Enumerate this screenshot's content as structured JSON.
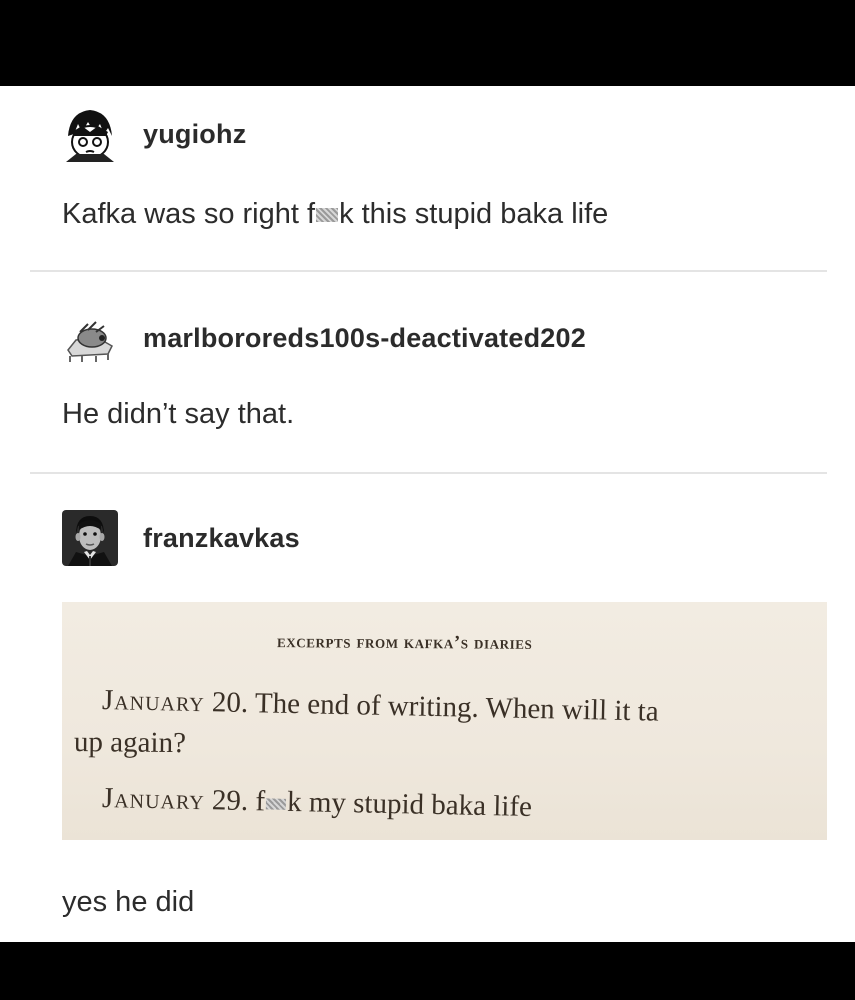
{
  "posts": [
    {
      "username": "yugiohz",
      "avatar_icon": "anime-avatar-icon",
      "text_before": "Kafka was so right f",
      "text_after": "k this stupid baka life"
    },
    {
      "username": "marlbororeds100s-deactivated202",
      "avatar_icon": "bug-avatar-icon",
      "text": "He didn’t say that."
    },
    {
      "username": "franzkavkas",
      "avatar_icon": "kafka-portrait-avatar-icon",
      "diary": {
        "heading": "EXCERPTS FROM KAFKA’S DIARIES",
        "entry1_month": "January",
        "entry1_text": " 20. The end of writing. When will it ta",
        "entry1_cont": "up again?",
        "entry2_month": "January",
        "entry2_before": " 29. f",
        "entry2_after": "k my  stupid baka life"
      },
      "reply_text": "yes he did"
    }
  ],
  "colors": {
    "frame": "#000000",
    "page": "#ffffff",
    "text": "#2c2c2c",
    "divider": "#e4e4e4",
    "paper": "#f0eadf"
  }
}
